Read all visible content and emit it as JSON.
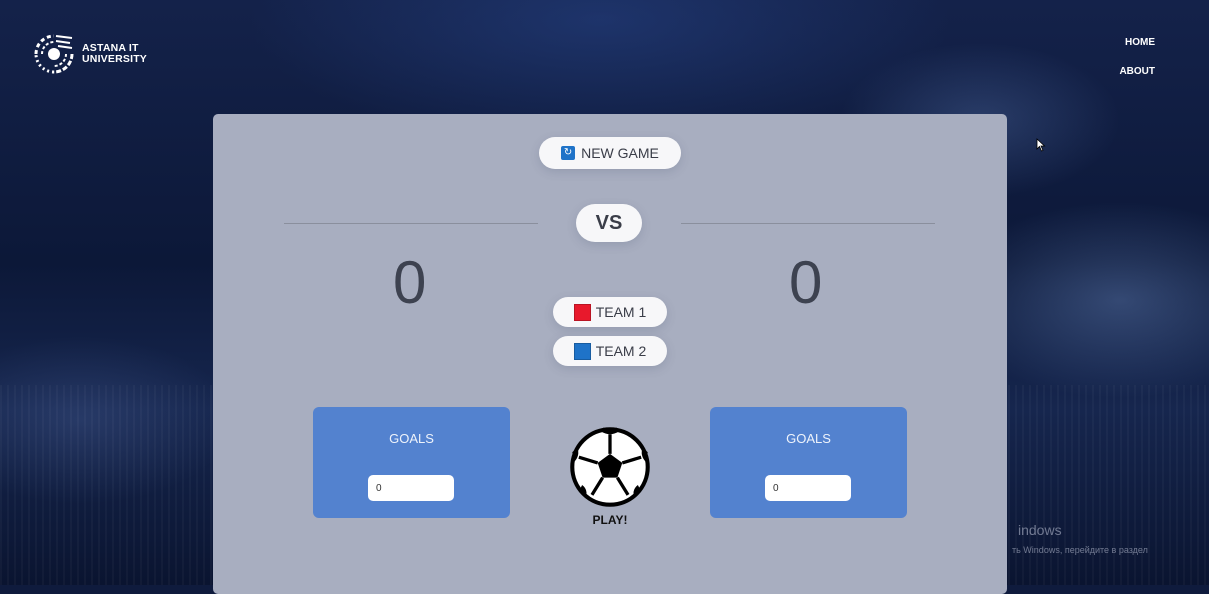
{
  "header": {
    "logo_line1": "ASTANA IT",
    "logo_line2": "UNIVERSITY",
    "nav": [
      "HOME",
      "ABOUT"
    ]
  },
  "game": {
    "new_game_label": "NEW GAME",
    "vs_label": "VS",
    "score_team1": "0",
    "score_team2": "0",
    "team1_label": "TEAM 1",
    "team2_label": "TEAM 2",
    "team1_color": "#e8192c",
    "team2_color": "#1f73c8",
    "goals_label_left": "GOALS",
    "goals_label_right": "GOALS",
    "goals_value_left": "0",
    "goals_value_right": "0",
    "play_label": "PLAY!"
  },
  "watermark": {
    "line1": "indows",
    "line2": "ть Windows, перейдите в раздел"
  }
}
